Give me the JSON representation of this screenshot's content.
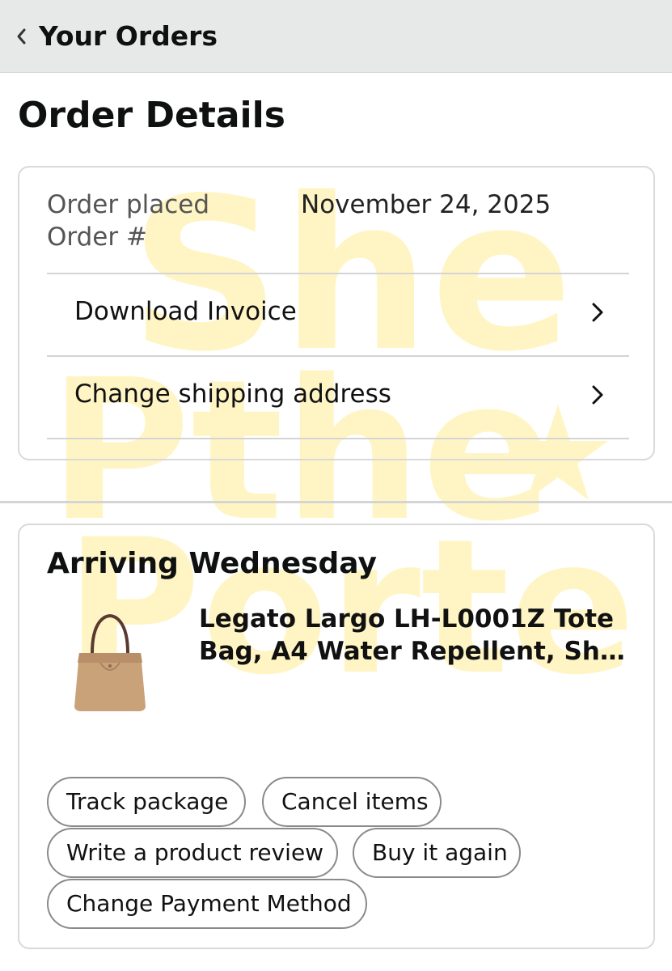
{
  "header": {
    "back_label": "Your Orders",
    "back_icon": "chevron-left-icon"
  },
  "page": {
    "title": "Order Details"
  },
  "order_info": {
    "placed_label": "Order placed",
    "placed_value": "November 24, 2025",
    "number_label": "Order #",
    "number_value": ""
  },
  "links": {
    "download_invoice": "Download Invoice",
    "change_address": "Change shipping address",
    "chevron_icon": "chevron-right-icon"
  },
  "shipment": {
    "status": "Arriving Wednesday",
    "product_title_line1": "Legato Largo LH-L0001Z Tote",
    "product_title_line2": "Bag, A4 Water Repellent, Sh…",
    "product_image_color": "#c9a27a"
  },
  "actions": {
    "track": "Track package",
    "cancel": "Cancel items",
    "review": "Write a product review",
    "buy_again": "Buy it again",
    "payment": "Change Payment Method"
  },
  "watermark": {
    "line1": "She",
    "line2": "Pthe",
    "line3": "Porter",
    "color": "#fff6c8"
  },
  "colors": {
    "header_bg": "#e7e8e8",
    "border": "#d9d9d9",
    "pill_border": "#8a8a8a",
    "text": "#0f1111"
  }
}
